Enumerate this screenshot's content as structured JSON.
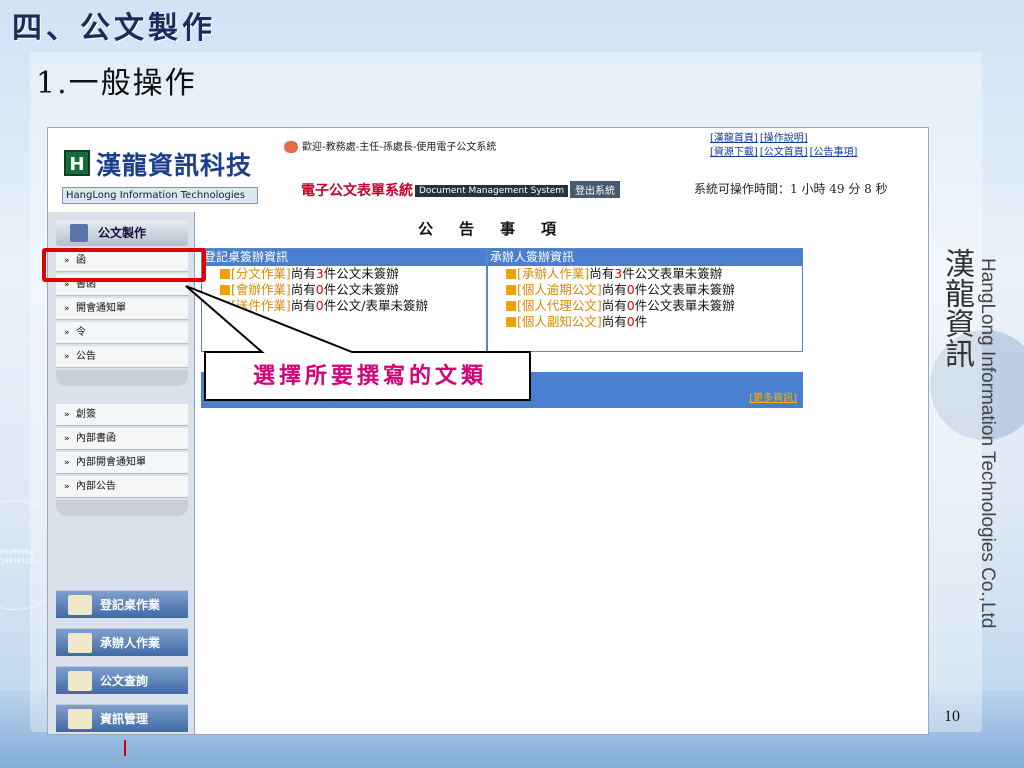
{
  "slide": {
    "heading": "四、公文製作",
    "subheading": "1.一般操作",
    "page_number": "10",
    "brand_cn": "漢龍資訊",
    "brand_en": "HangLong Information Technologies Co.,Ltd",
    "callout": "選擇所要撰寫的文類"
  },
  "app": {
    "logo_mark": "H",
    "logo_name": "漢龍資訊科技",
    "logo_en": "HangLong Information Technologies",
    "welcome": "歡迎-教務處-主任-孫處長-使用電子公文系統",
    "system_title": "電子公文表單系統",
    "system_en": "Document Management System",
    "logout": "登出系統",
    "top_links": [
      "[漢龍首頁]",
      "[操作說明]",
      "[資源下載]",
      "[公文首頁]",
      "[公告事項]"
    ],
    "op_time": "系統可操作時間：1 小時 49 分 8 秒"
  },
  "sidebar": {
    "header": "公文製作",
    "group1": [
      "函",
      "書函",
      "開會通知單",
      "令",
      "公告"
    ],
    "group2": [
      "創簽",
      "內部書函",
      "內部開會通知單",
      "內部公告"
    ],
    "buttons": [
      "登記桌作業",
      "承辦人作業",
      "公文查詢",
      "資訊管理"
    ]
  },
  "content": {
    "title": "公告事項",
    "left_panel": {
      "title": "登記桌簽辦資訊",
      "rows": [
        {
          "link": "[分文作業]",
          "pre": "尚有",
          "num": "3",
          "post": "件公文未簽辦"
        },
        {
          "link": "[會辦作業]",
          "pre": "尚有",
          "num": "0",
          "post": "件公文未簽辦"
        },
        {
          "link": "[送件作業]",
          "pre": "尚有",
          "num": "0",
          "post": "件公文/表單未簽辦"
        }
      ]
    },
    "right_panel": {
      "title": "承辦人簽辦資訊",
      "rows": [
        {
          "link": "[承辦人作業]",
          "pre": "尚有",
          "num": "3",
          "post": "件公文表單未簽辦"
        },
        {
          "link": "[個人逾期公文]",
          "pre": "尚有",
          "num": "0",
          "post": "件公文表單未簽辦"
        },
        {
          "link": "[個人代理公文]",
          "pre": "尚有",
          "num": "0",
          "post": "件公文表單未簽辦"
        },
        {
          "link": "[個人副知公文]",
          "pre": "尚有",
          "num": "0",
          "post": "件"
        }
      ]
    },
    "more": "[更多資訊]"
  }
}
